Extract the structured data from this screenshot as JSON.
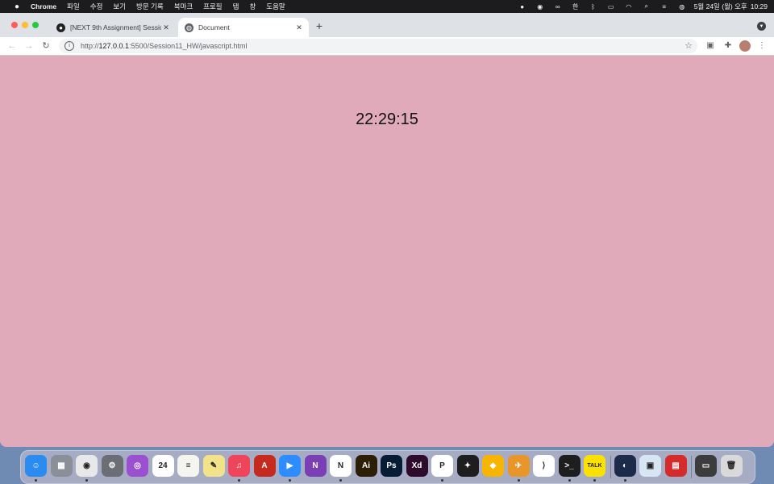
{
  "menubar": {
    "app_name": "Chrome",
    "items": [
      "파일",
      "수정",
      "보기",
      "방문 기록",
      "북마크",
      "프로필",
      "탭",
      "창",
      "도움말"
    ],
    "status_date": "5월 24일 (월) 오후",
    "status_time": "10:29",
    "input_indicator": "한"
  },
  "tabs": [
    {
      "title": "[NEXT 9th Assignment] Sessio",
      "icon": "github-icon",
      "active": false
    },
    {
      "title": "Document",
      "icon": "globe-icon",
      "active": true
    }
  ],
  "toolbar": {
    "url_prefix": "http://",
    "url_host": "127.0.0.1",
    "url_rest": ":5500/Session11_HW/javascript.html"
  },
  "page": {
    "clock": "22:29:15",
    "background_color": "#e0aabb"
  },
  "dock": {
    "apps": [
      {
        "name": "Finder",
        "color": "#2a8cf0",
        "glyph": "☺"
      },
      {
        "name": "Launchpad",
        "color": "#8a8f98",
        "glyph": "▦"
      },
      {
        "name": "Chrome",
        "color": "#e8e8e8",
        "glyph": "◉"
      },
      {
        "name": "System Preferences",
        "color": "#6b6f75",
        "glyph": "⚙"
      },
      {
        "name": "Podcasts",
        "color": "#9b4fd1",
        "glyph": "◎"
      },
      {
        "name": "Calendar",
        "color": "#ffffff",
        "glyph": "24"
      },
      {
        "name": "Notes",
        "color": "#f5f5f0",
        "glyph": "≡"
      },
      {
        "name": "Stickies",
        "color": "#f2e38a",
        "glyph": "✎"
      },
      {
        "name": "Music",
        "color": "#f0445a",
        "glyph": "♫"
      },
      {
        "name": "Acrobat",
        "color": "#c62a1e",
        "glyph": "A"
      },
      {
        "name": "Zoom",
        "color": "#2d8cff",
        "glyph": "▶"
      },
      {
        "name": "OneNote",
        "color": "#7b3fb5",
        "glyph": "N"
      },
      {
        "name": "Notion",
        "color": "#ffffff",
        "glyph": "N"
      },
      {
        "name": "Illustrator",
        "color": "#2d1e06",
        "glyph": "Ai"
      },
      {
        "name": "Photoshop",
        "color": "#071d33",
        "glyph": "Ps"
      },
      {
        "name": "XD",
        "color": "#2e0b2a",
        "glyph": "Xd"
      },
      {
        "name": "PicPick",
        "color": "#ffffff",
        "glyph": "P"
      },
      {
        "name": "Figma",
        "color": "#1e1e1e",
        "glyph": "✦"
      },
      {
        "name": "Sketch",
        "color": "#f7b500",
        "glyph": "◆"
      },
      {
        "name": "Cyberduck",
        "color": "#e8962a",
        "glyph": "✈"
      },
      {
        "name": "VS Code",
        "color": "#ffffff",
        "glyph": "⟩"
      },
      {
        "name": "Terminal",
        "color": "#1e1e1e",
        "glyph": ">_"
      },
      {
        "name": "KakaoTalk",
        "color": "#fae100",
        "glyph": "TALK"
      },
      {
        "name": "Cinema 4D",
        "color": "#1d2b4a",
        "glyph": "◐"
      },
      {
        "name": "Preview",
        "color": "#d8e6f3",
        "glyph": "▣"
      },
      {
        "name": "Photo Booth",
        "color": "#d62b2b",
        "glyph": "▤"
      },
      {
        "name": "Downloads",
        "color": "#3c3c3c",
        "glyph": "▭"
      },
      {
        "name": "Trash",
        "color": "#d9d9d9",
        "glyph": "🗑"
      }
    ]
  }
}
